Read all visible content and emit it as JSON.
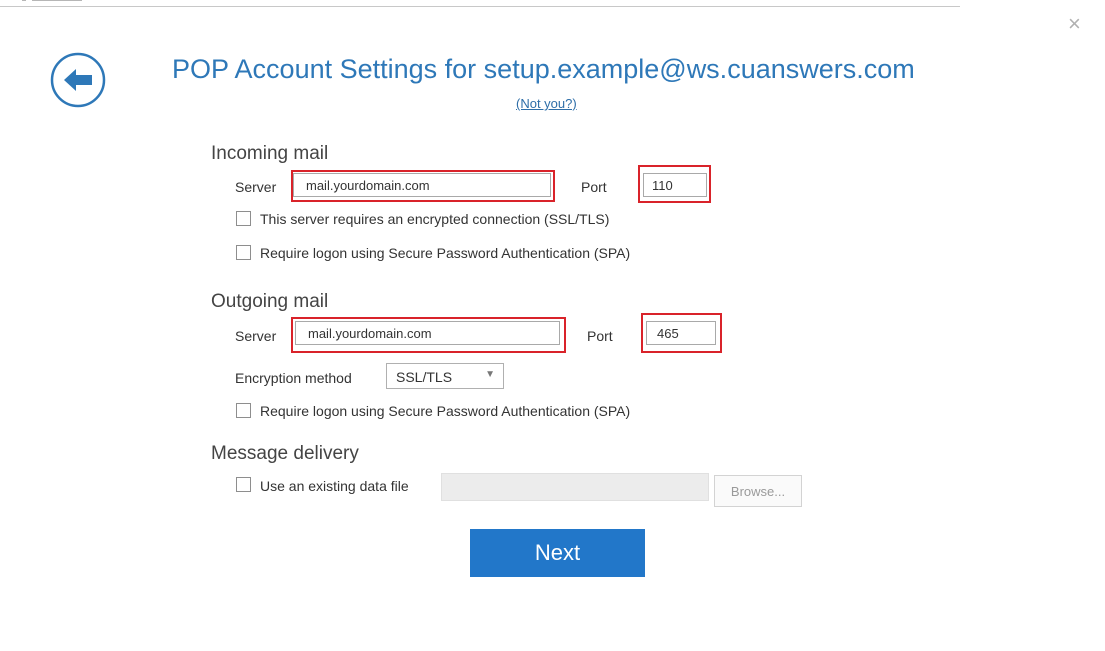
{
  "dialog": {
    "title": "POP Account Settings for setup.example@ws.cuanswers.com",
    "not_you": "(Not you?)",
    "close_glyph": "×"
  },
  "incoming": {
    "heading": "Incoming mail",
    "server_label": "Server",
    "server_value": "mail.yourdomain.com",
    "port_label": "Port",
    "port_value": "110",
    "ssl_label": "This server requires an encrypted connection (SSL/TLS)",
    "ssl_checked": false,
    "spa_label": "Require logon using Secure Password Authentication (SPA)",
    "spa_checked": false
  },
  "outgoing": {
    "heading": "Outgoing mail",
    "server_label": "Server",
    "server_value": "mail.yourdomain.com",
    "port_label": "Port",
    "port_value": "465",
    "encryption_label": "Encryption method",
    "encryption_value": "SSL/TLS",
    "spa_label": "Require logon using Secure Password Authentication (SPA)",
    "spa_checked": false
  },
  "delivery": {
    "heading": "Message delivery",
    "existing_label": "Use an existing data file",
    "existing_checked": false,
    "browse_label": "Browse..."
  },
  "actions": {
    "next_label": "Next"
  },
  "colors": {
    "accent": "#2e78b8",
    "button": "#2277c9",
    "highlight": "#d9232a"
  },
  "icons": {
    "back": "back-arrow-icon",
    "close": "close-icon",
    "dropdown": "chevron-down-icon"
  }
}
